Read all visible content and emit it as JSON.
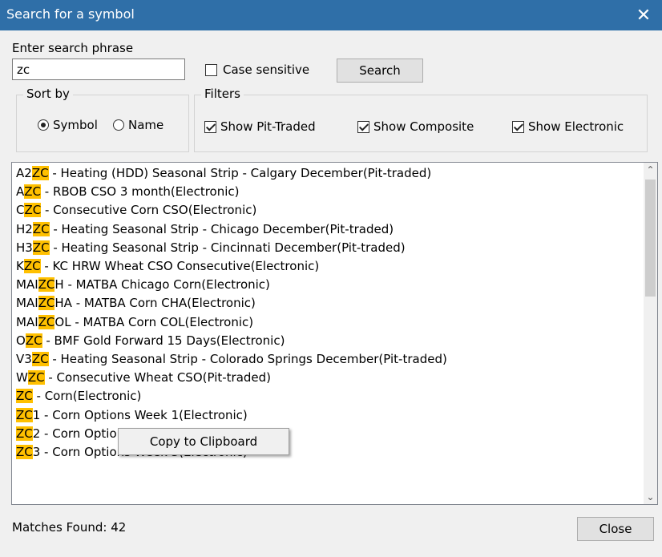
{
  "window": {
    "title": "Search for a symbol",
    "close_glyph": "✕"
  },
  "search": {
    "label": "Enter search phrase",
    "value": "zc",
    "case_sensitive_label": "Case sensitive",
    "case_sensitive_checked": false,
    "button_label": "Search"
  },
  "sort_by": {
    "legend": "Sort by",
    "options": [
      {
        "label": "Symbol",
        "selected": true
      },
      {
        "label": "Name",
        "selected": false
      }
    ]
  },
  "filters": {
    "legend": "Filters",
    "items": [
      {
        "label": "Show Pit-Traded",
        "checked": true
      },
      {
        "label": "Show Composite",
        "checked": true
      },
      {
        "label": "Show Electronic",
        "checked": true
      }
    ]
  },
  "results": [
    {
      "pre": "A2",
      "hl": "ZC",
      "post": " - Heating (HDD) Seasonal Strip - Calgary December(Pit-traded)"
    },
    {
      "pre": "A",
      "hl": "ZC",
      "post": " - RBOB CSO 3 month(Electronic)"
    },
    {
      "pre": "C",
      "hl": "ZC",
      "post": " - Consecutive Corn CSO(Electronic)"
    },
    {
      "pre": "H2",
      "hl": "ZC",
      "post": " - Heating Seasonal Strip - Chicago December(Pit-traded)"
    },
    {
      "pre": "H3",
      "hl": "ZC",
      "post": " - Heating Seasonal Strip - Cincinnati December(Pit-traded)"
    },
    {
      "pre": "K",
      "hl": "ZC",
      "post": " - KC HRW Wheat CSO Consecutive(Electronic)"
    },
    {
      "pre": "MAI",
      "hl": "ZC",
      "post": "H - MATBA Chicago Corn(Electronic)"
    },
    {
      "pre": "MAI",
      "hl": "ZC",
      "post": "HA - MATBA Corn CHA(Electronic)"
    },
    {
      "pre": "MAI",
      "hl": "ZC",
      "post": "OL - MATBA Corn COL(Electronic)"
    },
    {
      "pre": "O",
      "hl": "ZC",
      "post": " - BMF Gold Forward 15 Days(Electronic)"
    },
    {
      "pre": "V3",
      "hl": "ZC",
      "post": " - Heating Seasonal Strip - Colorado Springs December(Pit-traded)"
    },
    {
      "pre": "W",
      "hl": "ZC",
      "post": " - Consecutive Wheat CSO(Pit-traded)"
    },
    {
      "pre": "",
      "hl": "ZC",
      "post": " - Corn(Electronic)"
    },
    {
      "pre": "",
      "hl": "ZC",
      "post": "1 - Corn Options Week 1(Electronic)"
    },
    {
      "pre": "",
      "hl": "ZC",
      "post": "2 - Corn Options Week 2(Electronic)"
    },
    {
      "pre": "",
      "hl": "ZC",
      "post": "3 - Corn Options Week 3(Electronic)"
    }
  ],
  "context_menu": {
    "item": "Copy to Clipboard"
  },
  "footer": {
    "matches": "Matches Found: 42",
    "close_label": "Close"
  },
  "colors": {
    "titlebar": "#2f6fa8",
    "highlight": "#ffc000"
  },
  "icons": {
    "close": "close-icon",
    "scroll_up": "chevron-up-icon",
    "scroll_down": "chevron-down-icon"
  }
}
